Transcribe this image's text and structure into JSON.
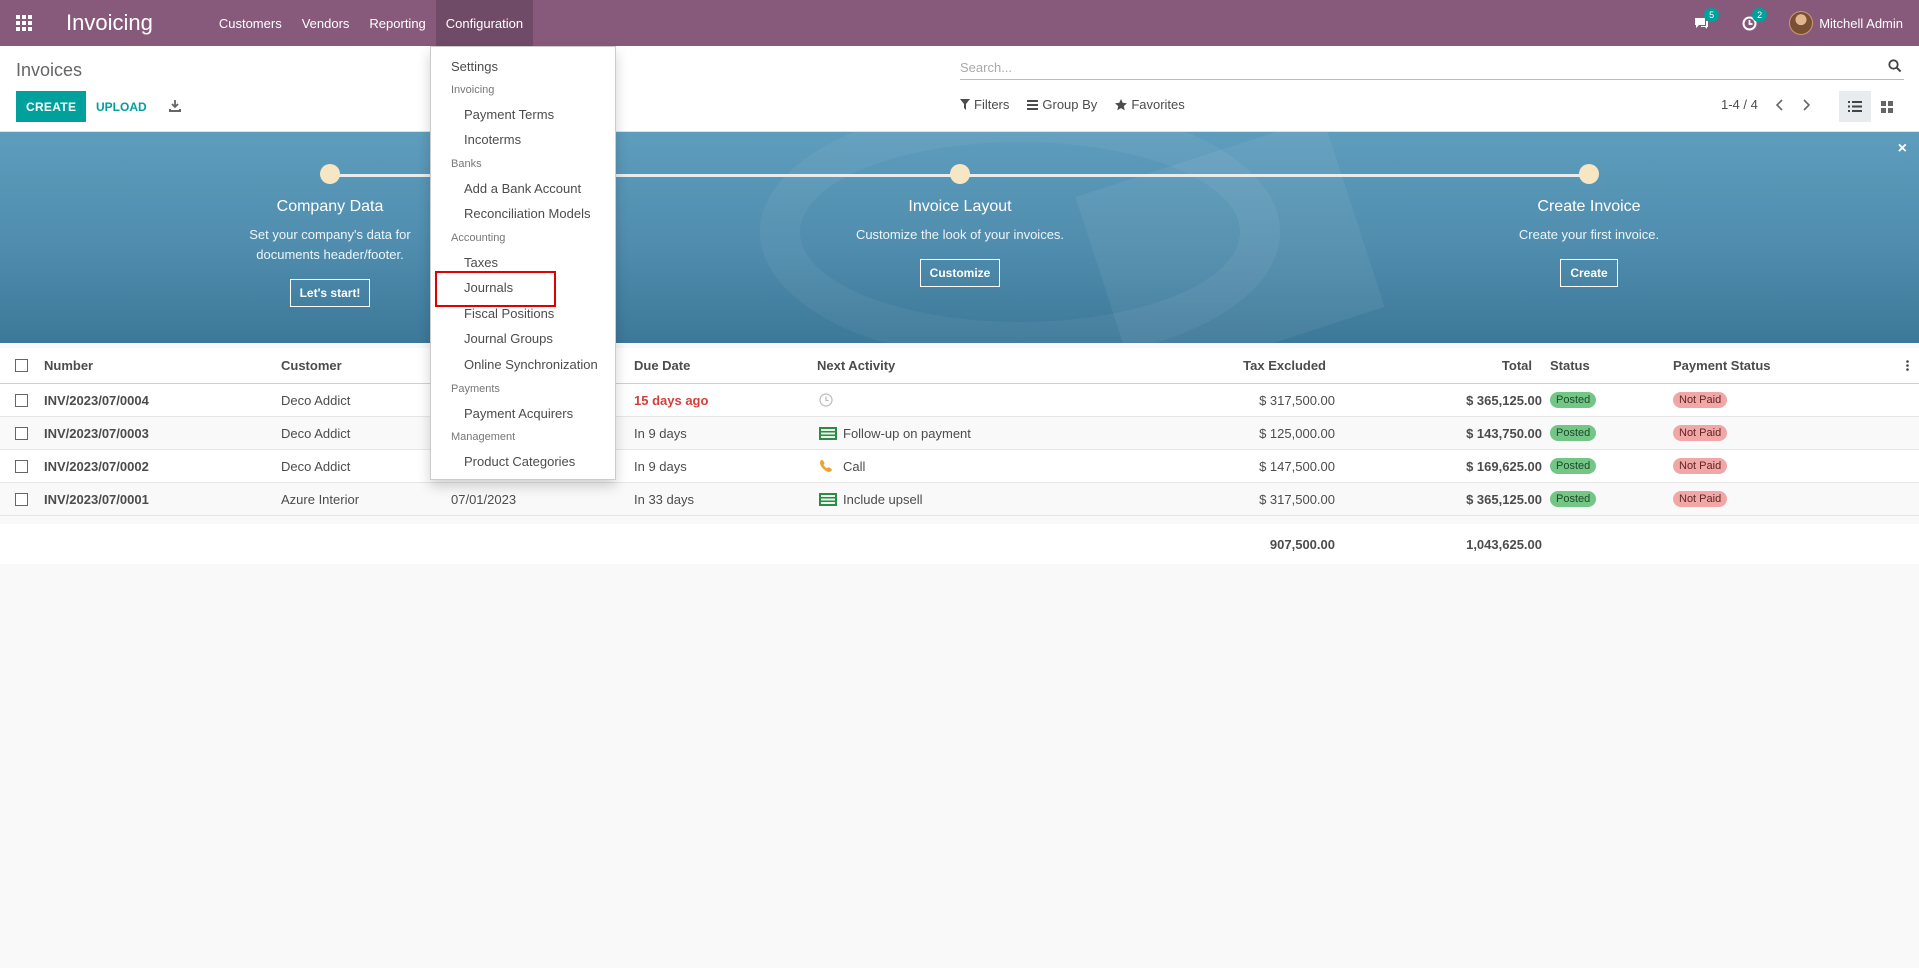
{
  "topbar": {
    "app_title": "Invoicing",
    "menu": [
      "Customers",
      "Vendors",
      "Reporting",
      "Configuration"
    ],
    "messages_count": "5",
    "activities_count": "2",
    "user_name": "Mitchell Admin",
    "color": "#875a7b"
  },
  "control_panel": {
    "breadcrumb": "Invoices",
    "create_label": "CREATE",
    "upload_label": "UPLOAD",
    "search_placeholder": "Search...",
    "filters_label": "Filters",
    "groupby_label": "Group By",
    "favorites_label": "Favorites",
    "pager": "1-4 / 4",
    "accent": "#00a09d"
  },
  "config_menu": {
    "settings": "Settings",
    "invoicing_header": "Invoicing",
    "payment_terms": "Payment Terms",
    "incoterms": "Incoterms",
    "banks_header": "Banks",
    "add_bank_account": "Add a Bank Account",
    "reconciliation_models": "Reconciliation Models",
    "accounting_header": "Accounting",
    "taxes": "Taxes",
    "journals": "Journals",
    "fiscal_positions": "Fiscal Positions",
    "journal_groups": "Journal Groups",
    "online_sync": "Online Synchronization",
    "payments_header": "Payments",
    "payment_acquirers": "Payment Acquirers",
    "management_header": "Management",
    "product_categories": "Product Categories"
  },
  "onboarding": {
    "steps": [
      {
        "title": "Company Data",
        "desc1": "Set your company's data for",
        "desc2": "documents header/footer.",
        "button": "Let's start!"
      },
      {
        "title": "Invoice Layout",
        "desc1": "Customize the look of your invoices.",
        "desc2": "",
        "button": "Customize"
      },
      {
        "title": "Create Invoice",
        "desc1": "Create your first invoice.",
        "desc2": "",
        "button": "Create"
      }
    ]
  },
  "table": {
    "headers": {
      "number": "Number",
      "customer": "Customer",
      "due_date": "Due Date",
      "next_activity": "Next Activity",
      "tax_excluded": "Tax Excluded",
      "total": "Total",
      "status": "Status",
      "payment_status": "Payment Status"
    },
    "rows": [
      {
        "number": "INV/2023/07/0004",
        "customer": "Deco Addict",
        "invoice_date": "",
        "due": "15 days ago",
        "activity": "",
        "activity_icon": "clock-icon",
        "tax_excluded": "$ 317,500.00",
        "total": "$ 365,125.00",
        "status": "Posted",
        "payment": "Not Paid"
      },
      {
        "number": "INV/2023/07/0003",
        "customer": "Deco Addict",
        "invoice_date": "",
        "due": "In 9 days",
        "activity": "Follow-up on payment",
        "activity_icon": "money-icon",
        "tax_excluded": "$ 125,000.00",
        "total": "$ 143,750.00",
        "status": "Posted",
        "payment": "Not Paid"
      },
      {
        "number": "INV/2023/07/0002",
        "customer": "Deco Addict",
        "invoice_date": "",
        "due": "In 9 days",
        "activity": "Call",
        "activity_icon": "phone-icon",
        "tax_excluded": "$ 147,500.00",
        "total": "$ 169,625.00",
        "status": "Posted",
        "payment": "Not Paid"
      },
      {
        "number": "INV/2023/07/0001",
        "customer": "Azure Interior",
        "invoice_date": "07/01/2023",
        "due": "In 33 days",
        "activity": "Include upsell",
        "activity_icon": "money-icon",
        "tax_excluded": "$ 317,500.00",
        "total": "$ 365,125.00",
        "status": "Posted",
        "payment": "Not Paid"
      }
    ],
    "totals": {
      "tax_excluded": "907,500.00",
      "total": "1,043,625.00"
    }
  }
}
